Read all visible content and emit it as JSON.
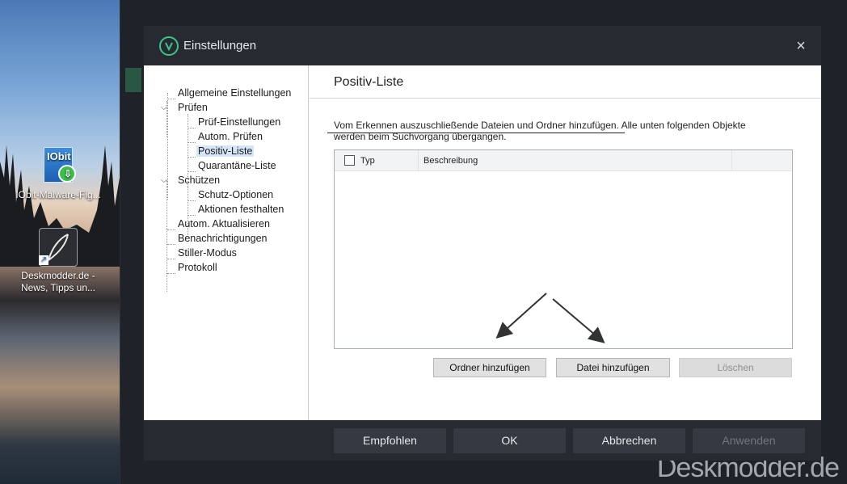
{
  "desktop": {
    "icons": [
      {
        "label": "IObit-Malware-Fig...",
        "icon": "iobit-malware-fighter-icon"
      },
      {
        "label": "Deskmodder.de - News, Tipps un...",
        "icon": "feather-shortcut-icon"
      }
    ]
  },
  "watermark": "Deskmodder.de",
  "dialog": {
    "title": "Einstellungen",
    "close_label": "×",
    "tree": {
      "allgemein": "Allgemeine Einstellungen",
      "pruefen": "Prüfen",
      "pruef_einstellungen": "Prüf-Einstellungen",
      "autom_pruefen": "Autom. Prüfen",
      "positiv_liste": "Positiv-Liste",
      "quarantaene": "Quarantäne-Liste",
      "schuetzen": "Schützen",
      "schutz_optionen": "Schutz-Optionen",
      "aktionen": "Aktionen festhalten",
      "autom_aktualisieren": "Autom. Aktualisieren",
      "benachrichtigungen": "Benachrichtigungen",
      "stiller_modus": "Stiller-Modus",
      "protokoll": "Protokoll",
      "selected": "Positiv-Liste"
    },
    "panel": {
      "title": "Positiv-Liste",
      "description_line1": "Vom Erkennen auszuschließende Dateien und Ordner hinzufügen. Alle unten folgenden Objekte",
      "description_line2": "werden beim Suchvorgang übergangen.",
      "columns": [
        "Typ",
        "Beschreibung"
      ],
      "rows": [],
      "buttons": {
        "add_folder": "Ordner hinzufügen",
        "add_file": "Datei hinzufügen",
        "delete": "Löschen"
      }
    },
    "footer": {
      "recommended": "Empfohlen",
      "ok": "OK",
      "cancel": "Abbrechen",
      "apply": "Anwenden"
    }
  },
  "colors": {
    "accent": "#3cc48a",
    "dialog_dark": "#272b31",
    "footer_button": "#353941",
    "selection": "#d5e6f8"
  }
}
